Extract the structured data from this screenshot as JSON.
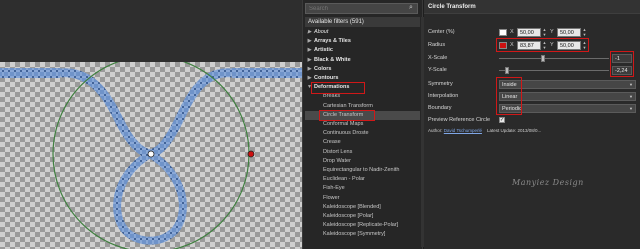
{
  "search": {
    "placeholder": "Search"
  },
  "filter_list": {
    "header": "Available filters (591)",
    "categories": [
      {
        "label": "About",
        "italic": true
      },
      {
        "label": "Arrays & Tiles"
      },
      {
        "label": "Artistic"
      },
      {
        "label": "Black & White"
      },
      {
        "label": "Colors"
      },
      {
        "label": "Contours"
      },
      {
        "label": "Deformations",
        "expanded": true
      }
    ],
    "items": [
      "Breaks",
      "Cartesian Transform",
      "Circle Transform",
      "Conformal Maps",
      "Continuous Droste",
      "Crease",
      "Distort Lens",
      "Drop Water",
      "Equirectangular to Nadir-Zenith",
      "Euclidean - Polar",
      "Fish-Eye",
      "Flower",
      "Kaleidoscope [Blended]",
      "Kaleidoscope [Polar]",
      "Kaleidoscope [Replicate-Polar]",
      "Kaleidoscope [Symmetry]"
    ],
    "selected": "Circle Transform"
  },
  "params": {
    "title": "Circle Transform",
    "center": {
      "label": "Center (%)",
      "color": "#ffffff",
      "x_label": "X",
      "x": "50,00",
      "y_label": "Y",
      "y": "50,00"
    },
    "radius": {
      "label": "Radius",
      "color": "#cc1010",
      "x_label": "X",
      "x": "83,87",
      "y_label": "Y",
      "y": "50,00"
    },
    "x_scale": {
      "label": "X-Scale",
      "value": "-1",
      "level": 0.4
    },
    "y_scale": {
      "label": "Y-Scale",
      "value": "-2,24",
      "level": 0.07
    },
    "symmetry": {
      "label": "Symmetry",
      "value": "Inside"
    },
    "interpolation": {
      "label": "Interpolation",
      "value": "Linear"
    },
    "boundary": {
      "label": "Boundary",
      "value": "Periodic"
    },
    "preview_ref": {
      "label": "Preview Reference Circle",
      "checked": true
    },
    "author": {
      "prefix": "Author:",
      "name": "David Tschumperlé",
      "latest": "Latest Update: 2013/08/0..."
    }
  },
  "watermark": "Manyiez Design",
  "colors": {
    "highlight": "#d01818",
    "accent_red": "#cc1010",
    "ref_circle": "#3f7f3f"
  }
}
